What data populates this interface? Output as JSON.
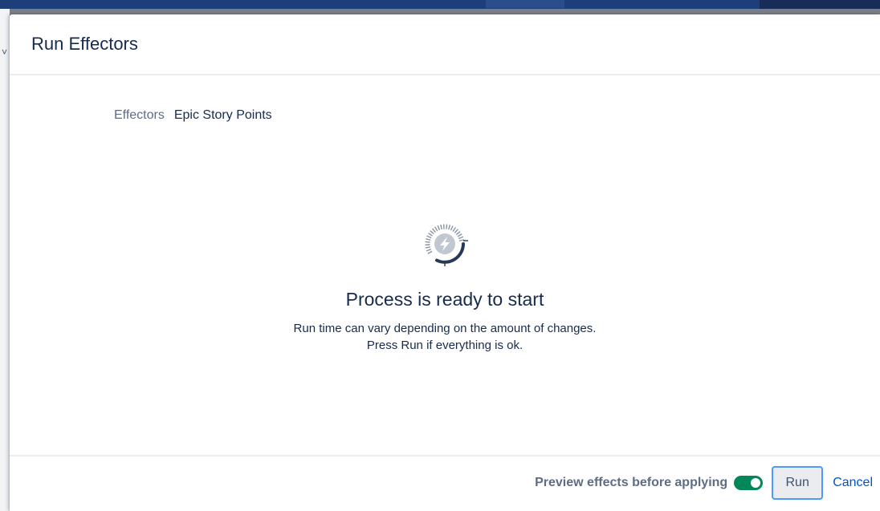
{
  "dialog": {
    "title": "Run Effectors"
  },
  "field": {
    "label": "Effectors",
    "value": "Epic Story Points"
  },
  "status": {
    "icon": "gauge-lightning-icon",
    "title": "Process is ready to start",
    "line1": "Run time can vary depending on the amount of changes.",
    "line2": "Press Run if everything is ok."
  },
  "footer": {
    "preview_label": "Preview effects before applying",
    "preview_enabled": true,
    "run_label": "Run",
    "cancel_label": "Cancel"
  },
  "colors": {
    "toggle_on": "#00875a",
    "focus_ring": "#4c9aff",
    "link": "#0052cc",
    "topbar": "#1e3e7a"
  }
}
